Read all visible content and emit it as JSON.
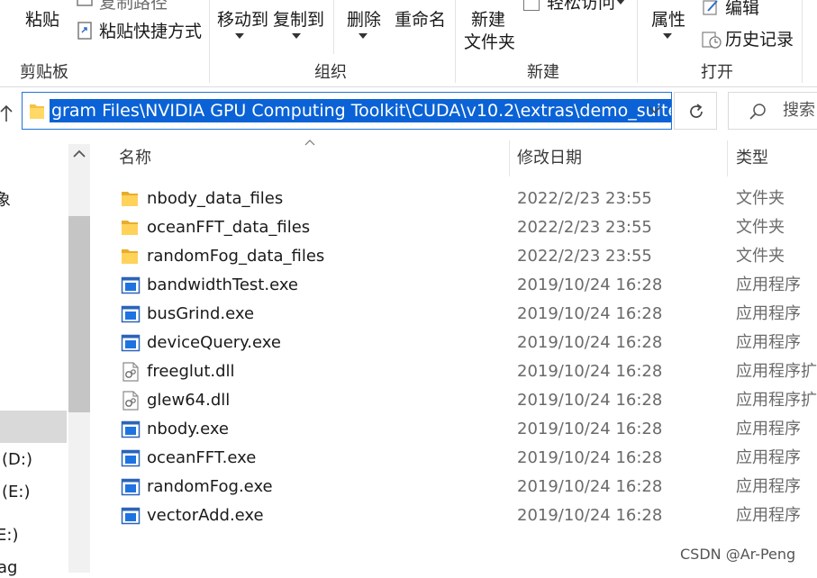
{
  "ribbon": {
    "clipboard": {
      "paste": "粘贴",
      "copy_path": "复制路径",
      "paste_shortcut": "粘贴快捷方式",
      "group_label": "剪贴板"
    },
    "organize": {
      "move_to": "移动到",
      "copy_to": "复制到",
      "delete": "删除",
      "rename": "重命名",
      "group_label": "组织"
    },
    "new": {
      "new_folder_line1": "新建",
      "new_folder_line2": "文件夹",
      "easy_access": "轻松访问",
      "group_label": "新建"
    },
    "open": {
      "properties": "属性",
      "edit": "编辑",
      "history": "历史记录",
      "group_label": "打开"
    }
  },
  "address": {
    "path": "gram Files\\NVIDIA GPU Computing Toolkit\\CUDA\\v10.2\\extras\\demo_suite",
    "search_placeholder": "搜索"
  },
  "nav": {
    "items": [
      "象",
      "(D:)",
      "(E:)",
      "E:)",
      "ag"
    ]
  },
  "columns": {
    "name": "名称",
    "date": "修改日期",
    "type": "类型"
  },
  "files": [
    {
      "name": "nbody_data_files",
      "date": "2022/2/23 23:55",
      "type": "文件夹",
      "icon": "folder-icon"
    },
    {
      "name": "oceanFFT_data_files",
      "date": "2022/2/23 23:55",
      "type": "文件夹",
      "icon": "folder-icon"
    },
    {
      "name": "randomFog_data_files",
      "date": "2022/2/23 23:55",
      "type": "文件夹",
      "icon": "folder-icon"
    },
    {
      "name": "bandwidthTest.exe",
      "date": "2019/10/24 16:28",
      "type": "应用程序",
      "icon": "exe-icon"
    },
    {
      "name": "busGrind.exe",
      "date": "2019/10/24 16:28",
      "type": "应用程序",
      "icon": "exe-icon"
    },
    {
      "name": "deviceQuery.exe",
      "date": "2019/10/24 16:28",
      "type": "应用程序",
      "icon": "exe-icon"
    },
    {
      "name": "freeglut.dll",
      "date": "2019/10/24 16:28",
      "type": "应用程序扩",
      "icon": "dll-icon"
    },
    {
      "name": "glew64.dll",
      "date": "2019/10/24 16:28",
      "type": "应用程序扩",
      "icon": "dll-icon"
    },
    {
      "name": "nbody.exe",
      "date": "2019/10/24 16:28",
      "type": "应用程序",
      "icon": "exe-icon"
    },
    {
      "name": "oceanFFT.exe",
      "date": "2019/10/24 16:28",
      "type": "应用程序",
      "icon": "exe-icon"
    },
    {
      "name": "randomFog.exe",
      "date": "2019/10/24 16:28",
      "type": "应用程序",
      "icon": "exe-icon"
    },
    {
      "name": "vectorAdd.exe",
      "date": "2019/10/24 16:28",
      "type": "应用程序",
      "icon": "exe-icon"
    }
  ],
  "watermark": "CSDN @Ar-Peng",
  "colors": {
    "selection": "#0a62d6",
    "address_border": "#1f73d8",
    "folder": "#f5c242"
  }
}
